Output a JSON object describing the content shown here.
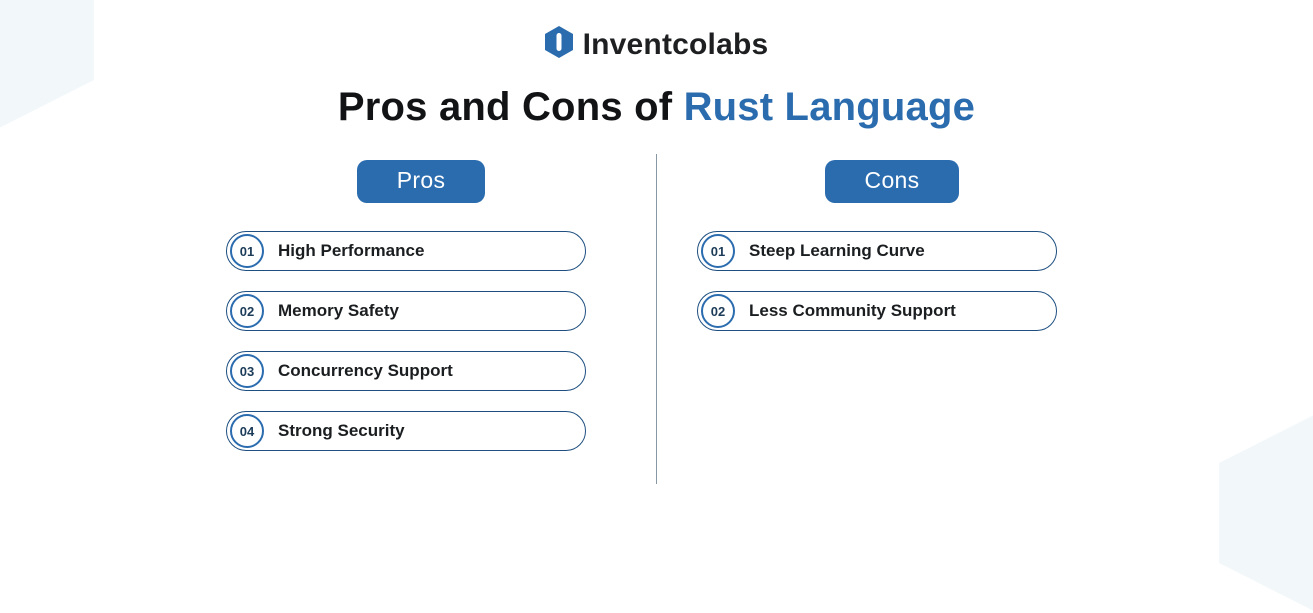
{
  "brand": {
    "name": "Inventcolabs",
    "logo_letter": "I"
  },
  "title": {
    "prefix": "Pros and Cons of ",
    "accent": "Rust Language"
  },
  "columns": {
    "pros": {
      "heading": "Pros",
      "items": [
        {
          "num": "01",
          "label": "High Performance"
        },
        {
          "num": "02",
          "label": "Memory Safety"
        },
        {
          "num": "03",
          "label": "Concurrency Support"
        },
        {
          "num": "04",
          "label": "Strong Security"
        }
      ]
    },
    "cons": {
      "heading": "Cons",
      "items": [
        {
          "num": "01",
          "label": "Steep Learning Curve"
        },
        {
          "num": "02",
          "label": "Less Community Support"
        }
      ]
    }
  },
  "colors": {
    "brand_blue": "#2b6caf",
    "light_hex": "#dfeaf3",
    "dark": "#111315"
  }
}
